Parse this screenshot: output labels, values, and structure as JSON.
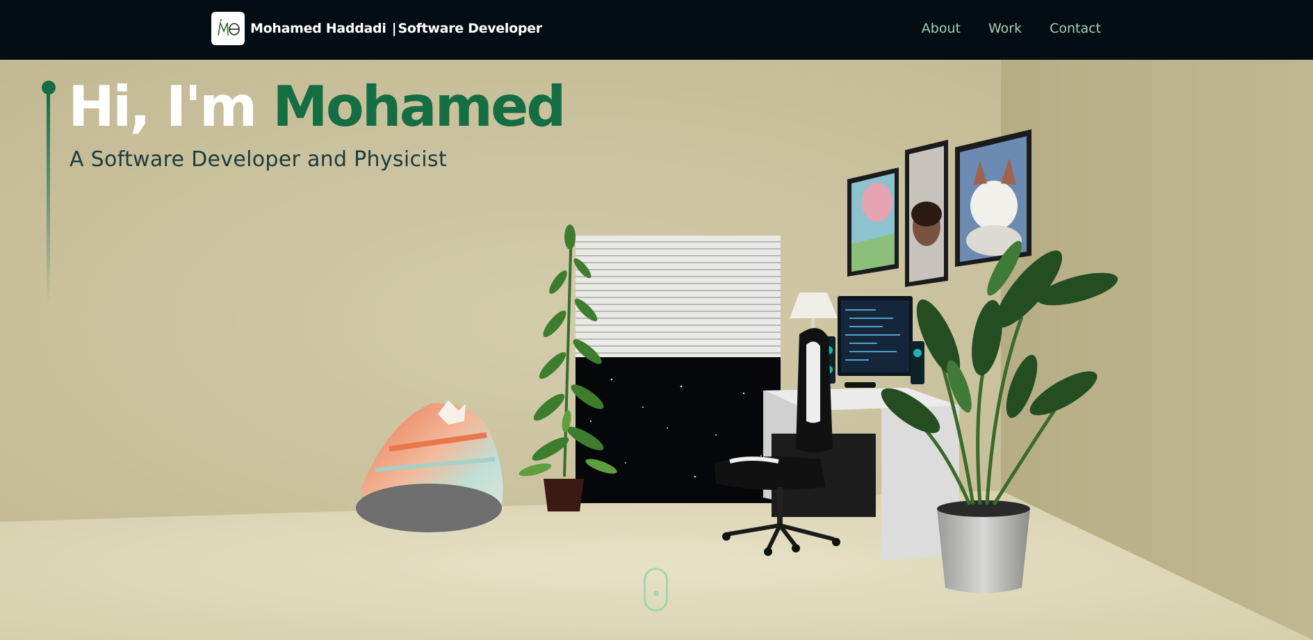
{
  "nav": {
    "logo_alt": "MH",
    "brand_name": "Mohamed Haddadi",
    "brand_separator": "|",
    "brand_role": "Software Developer",
    "links": [
      {
        "label": "About"
      },
      {
        "label": "Work"
      },
      {
        "label": "Contact"
      }
    ]
  },
  "hero": {
    "greeting": "Hi, I'm",
    "name": "Mohamed",
    "subtitle": "A Software Developer and Physicist"
  },
  "icons": {
    "logo": "mh-monogram-logo",
    "scroll": "mouse-scroll-icon"
  },
  "colors": {
    "nav_bg": "#050d14",
    "accent": "#156d43",
    "nav_link": "#a4d4b1",
    "wall": "#c9c19b",
    "floor": "#dcd6b6",
    "subtitle": "#1c3b3d"
  }
}
